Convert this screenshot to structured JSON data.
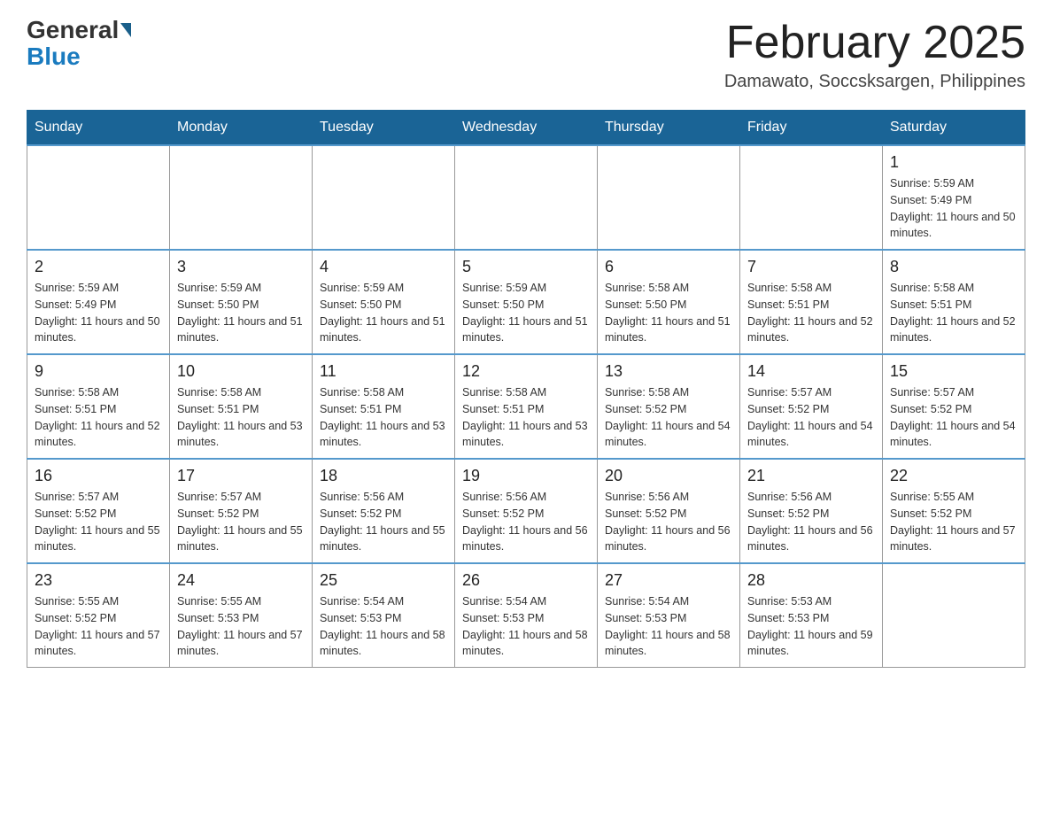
{
  "header": {
    "logo_general": "General",
    "logo_blue": "Blue",
    "month_title": "February 2025",
    "location": "Damawato, Soccsksargen, Philippines"
  },
  "days_of_week": [
    "Sunday",
    "Monday",
    "Tuesday",
    "Wednesday",
    "Thursday",
    "Friday",
    "Saturday"
  ],
  "weeks": [
    [
      {
        "day": "",
        "sunrise": "",
        "sunset": "",
        "daylight": ""
      },
      {
        "day": "",
        "sunrise": "",
        "sunset": "",
        "daylight": ""
      },
      {
        "day": "",
        "sunrise": "",
        "sunset": "",
        "daylight": ""
      },
      {
        "day": "",
        "sunrise": "",
        "sunset": "",
        "daylight": ""
      },
      {
        "day": "",
        "sunrise": "",
        "sunset": "",
        "daylight": ""
      },
      {
        "day": "",
        "sunrise": "",
        "sunset": "",
        "daylight": ""
      },
      {
        "day": "1",
        "sunrise": "Sunrise: 5:59 AM",
        "sunset": "Sunset: 5:49 PM",
        "daylight": "Daylight: 11 hours and 50 minutes."
      }
    ],
    [
      {
        "day": "2",
        "sunrise": "Sunrise: 5:59 AM",
        "sunset": "Sunset: 5:49 PM",
        "daylight": "Daylight: 11 hours and 50 minutes."
      },
      {
        "day": "3",
        "sunrise": "Sunrise: 5:59 AM",
        "sunset": "Sunset: 5:50 PM",
        "daylight": "Daylight: 11 hours and 51 minutes."
      },
      {
        "day": "4",
        "sunrise": "Sunrise: 5:59 AM",
        "sunset": "Sunset: 5:50 PM",
        "daylight": "Daylight: 11 hours and 51 minutes."
      },
      {
        "day": "5",
        "sunrise": "Sunrise: 5:59 AM",
        "sunset": "Sunset: 5:50 PM",
        "daylight": "Daylight: 11 hours and 51 minutes."
      },
      {
        "day": "6",
        "sunrise": "Sunrise: 5:58 AM",
        "sunset": "Sunset: 5:50 PM",
        "daylight": "Daylight: 11 hours and 51 minutes."
      },
      {
        "day": "7",
        "sunrise": "Sunrise: 5:58 AM",
        "sunset": "Sunset: 5:51 PM",
        "daylight": "Daylight: 11 hours and 52 minutes."
      },
      {
        "day": "8",
        "sunrise": "Sunrise: 5:58 AM",
        "sunset": "Sunset: 5:51 PM",
        "daylight": "Daylight: 11 hours and 52 minutes."
      }
    ],
    [
      {
        "day": "9",
        "sunrise": "Sunrise: 5:58 AM",
        "sunset": "Sunset: 5:51 PM",
        "daylight": "Daylight: 11 hours and 52 minutes."
      },
      {
        "day": "10",
        "sunrise": "Sunrise: 5:58 AM",
        "sunset": "Sunset: 5:51 PM",
        "daylight": "Daylight: 11 hours and 53 minutes."
      },
      {
        "day": "11",
        "sunrise": "Sunrise: 5:58 AM",
        "sunset": "Sunset: 5:51 PM",
        "daylight": "Daylight: 11 hours and 53 minutes."
      },
      {
        "day": "12",
        "sunrise": "Sunrise: 5:58 AM",
        "sunset": "Sunset: 5:51 PM",
        "daylight": "Daylight: 11 hours and 53 minutes."
      },
      {
        "day": "13",
        "sunrise": "Sunrise: 5:58 AM",
        "sunset": "Sunset: 5:52 PM",
        "daylight": "Daylight: 11 hours and 54 minutes."
      },
      {
        "day": "14",
        "sunrise": "Sunrise: 5:57 AM",
        "sunset": "Sunset: 5:52 PM",
        "daylight": "Daylight: 11 hours and 54 minutes."
      },
      {
        "day": "15",
        "sunrise": "Sunrise: 5:57 AM",
        "sunset": "Sunset: 5:52 PM",
        "daylight": "Daylight: 11 hours and 54 minutes."
      }
    ],
    [
      {
        "day": "16",
        "sunrise": "Sunrise: 5:57 AM",
        "sunset": "Sunset: 5:52 PM",
        "daylight": "Daylight: 11 hours and 55 minutes."
      },
      {
        "day": "17",
        "sunrise": "Sunrise: 5:57 AM",
        "sunset": "Sunset: 5:52 PM",
        "daylight": "Daylight: 11 hours and 55 minutes."
      },
      {
        "day": "18",
        "sunrise": "Sunrise: 5:56 AM",
        "sunset": "Sunset: 5:52 PM",
        "daylight": "Daylight: 11 hours and 55 minutes."
      },
      {
        "day": "19",
        "sunrise": "Sunrise: 5:56 AM",
        "sunset": "Sunset: 5:52 PM",
        "daylight": "Daylight: 11 hours and 56 minutes."
      },
      {
        "day": "20",
        "sunrise": "Sunrise: 5:56 AM",
        "sunset": "Sunset: 5:52 PM",
        "daylight": "Daylight: 11 hours and 56 minutes."
      },
      {
        "day": "21",
        "sunrise": "Sunrise: 5:56 AM",
        "sunset": "Sunset: 5:52 PM",
        "daylight": "Daylight: 11 hours and 56 minutes."
      },
      {
        "day": "22",
        "sunrise": "Sunrise: 5:55 AM",
        "sunset": "Sunset: 5:52 PM",
        "daylight": "Daylight: 11 hours and 57 minutes."
      }
    ],
    [
      {
        "day": "23",
        "sunrise": "Sunrise: 5:55 AM",
        "sunset": "Sunset: 5:52 PM",
        "daylight": "Daylight: 11 hours and 57 minutes."
      },
      {
        "day": "24",
        "sunrise": "Sunrise: 5:55 AM",
        "sunset": "Sunset: 5:53 PM",
        "daylight": "Daylight: 11 hours and 57 minutes."
      },
      {
        "day": "25",
        "sunrise": "Sunrise: 5:54 AM",
        "sunset": "Sunset: 5:53 PM",
        "daylight": "Daylight: 11 hours and 58 minutes."
      },
      {
        "day": "26",
        "sunrise": "Sunrise: 5:54 AM",
        "sunset": "Sunset: 5:53 PM",
        "daylight": "Daylight: 11 hours and 58 minutes."
      },
      {
        "day": "27",
        "sunrise": "Sunrise: 5:54 AM",
        "sunset": "Sunset: 5:53 PM",
        "daylight": "Daylight: 11 hours and 58 minutes."
      },
      {
        "day": "28",
        "sunrise": "Sunrise: 5:53 AM",
        "sunset": "Sunset: 5:53 PM",
        "daylight": "Daylight: 11 hours and 59 minutes."
      },
      {
        "day": "",
        "sunrise": "",
        "sunset": "",
        "daylight": ""
      }
    ]
  ]
}
